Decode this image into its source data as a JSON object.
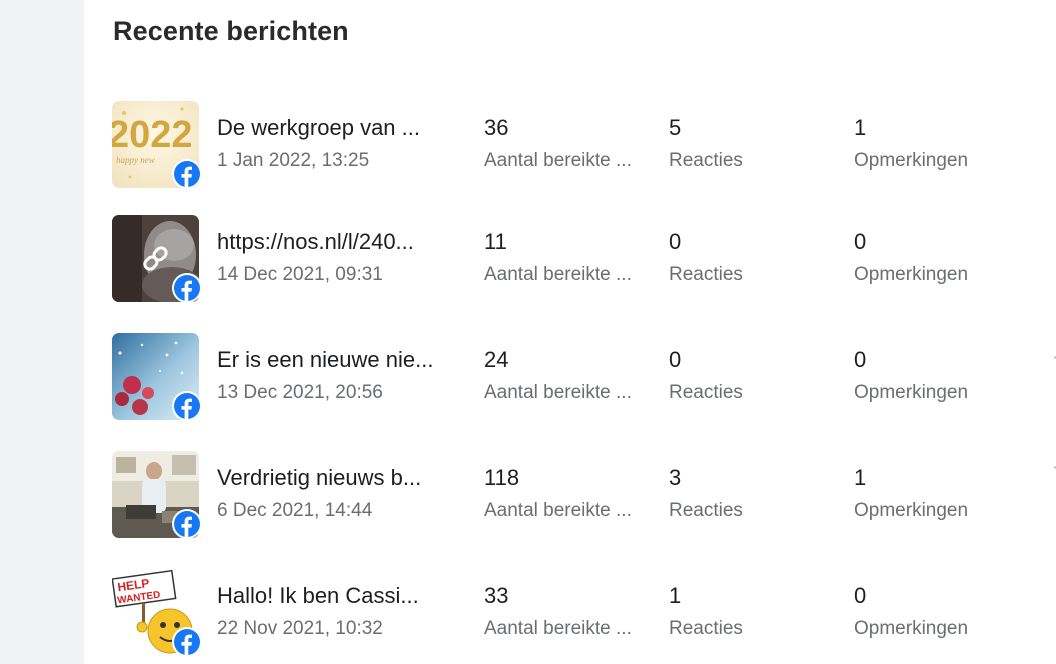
{
  "section": {
    "title": "Recente berichten"
  },
  "posts": [
    {
      "title": "De werkgroep van ...",
      "date": "1 Jan 2022, 13:25",
      "reach": "36",
      "reach_label": "Aantal bereikte ...",
      "reactions": "5",
      "reactions_label": "Reacties",
      "comments": "1",
      "comments_label": "Opmerkingen",
      "thumbnail": "new-year-2022-image",
      "thumbnail_text": "2022",
      "platform_icon": "facebook-icon"
    },
    {
      "title": "https://nos.nl/l/240...",
      "date": "14 Dec 2021, 09:31",
      "reach": "11",
      "reach_label": "Aantal bereikte ...",
      "reactions": "0",
      "reactions_label": "Reacties",
      "comments": "0",
      "comments_label": "Opmerkingen",
      "thumbnail": "link-preview-image",
      "platform_icon": "facebook-icon"
    },
    {
      "title": "Er is een nieuwe nie...",
      "date": "13 Dec 2021, 20:56",
      "reach": "24",
      "reach_label": "Aantal bereikte ...",
      "reactions": "0",
      "reactions_label": "Reacties",
      "comments": "0",
      "comments_label": "Opmerkingen",
      "thumbnail": "winter-christmas-image",
      "platform_icon": "facebook-icon"
    },
    {
      "title": "Verdrietig nieuws b...",
      "date": "6 Dec 2021, 14:44",
      "reach": "118",
      "reach_label": "Aantal bereikte ...",
      "reactions": "3",
      "reactions_label": "Reacties",
      "comments": "1",
      "comments_label": "Opmerkingen",
      "thumbnail": "person-photo-image",
      "platform_icon": "facebook-icon"
    },
    {
      "title": "Hallo! Ik ben Cassi...",
      "date": "22 Nov 2021, 10:32",
      "reach": "33",
      "reach_label": "Aantal bereikte ...",
      "reactions": "1",
      "reactions_label": "Reacties",
      "comments": "0",
      "comments_label": "Opmerkingen",
      "thumbnail": "help-wanted-image",
      "thumbnail_text": "HELP WANTED",
      "platform_icon": "facebook-icon"
    }
  ],
  "colors": {
    "facebook_blue": "#1877f2",
    "text_primary": "#1c1e21",
    "text_secondary": "#6a6d72",
    "rail_background": "#f0f2f5"
  }
}
